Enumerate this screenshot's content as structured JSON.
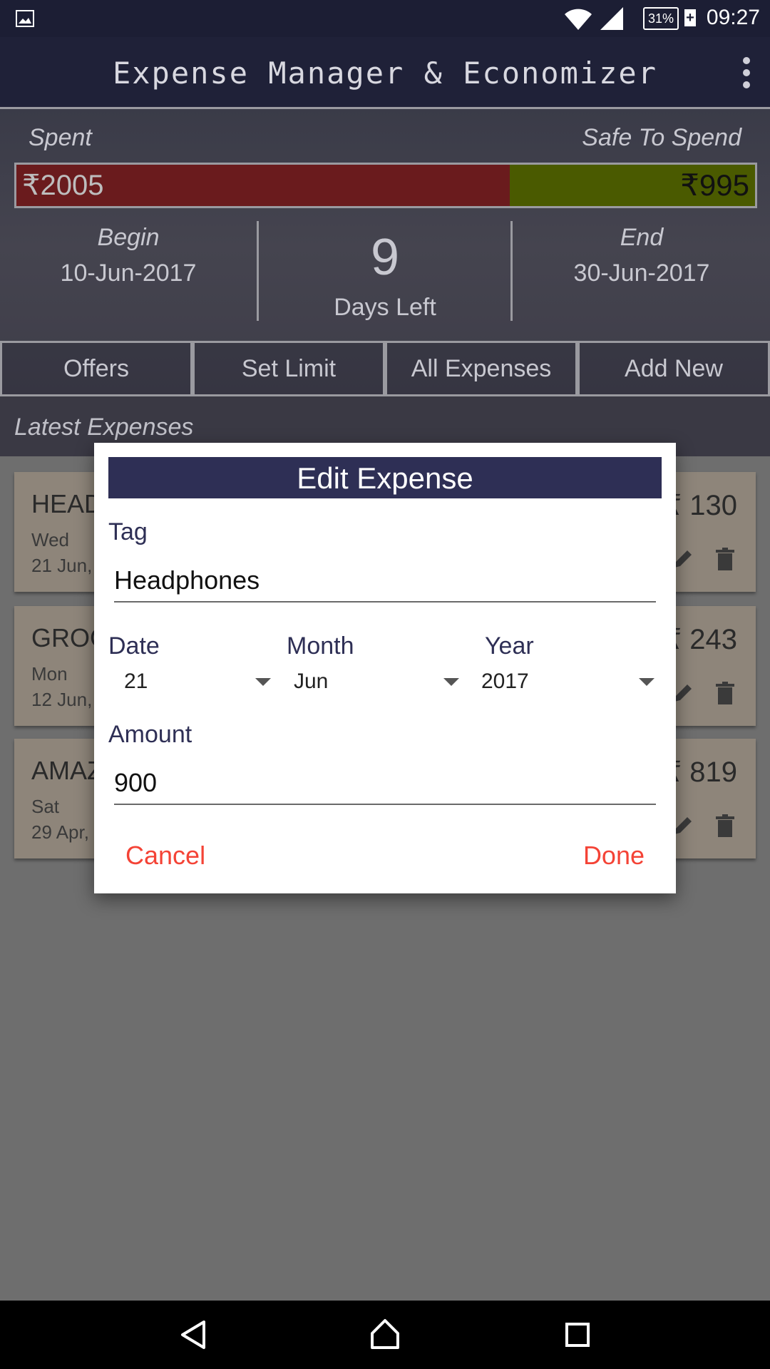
{
  "status_bar": {
    "time": "09:27",
    "battery": "31%",
    "icons": [
      "gallery-icon",
      "wifi-icon",
      "signal-icon",
      "battery-icon"
    ]
  },
  "app_bar": {
    "title": "Expense Manager & Economizer",
    "menu_icon": "more-vert-icon"
  },
  "summary": {
    "spent_label": "Spent",
    "safe_label": "Safe To Spend",
    "spent_value": "₹2005",
    "safe_value": "₹995",
    "spent_fraction": 0.668,
    "begin_label": "Begin",
    "begin_date": "10-Jun-2017",
    "days_left": "9",
    "days_left_label": "Days Left",
    "end_label": "End",
    "end_date": "30-Jun-2017"
  },
  "tabs": [
    {
      "label": "Offers"
    },
    {
      "label": "Set Limit"
    },
    {
      "label": "All Expenses"
    },
    {
      "label": "Add New"
    }
  ],
  "latest_label": "Latest Expenses",
  "expenses": [
    {
      "name": "HEAD",
      "day": "Wed",
      "date": "21 Jun,",
      "amount": "130"
    },
    {
      "name": "GROC",
      "day": "Mon",
      "date": "12 Jun,",
      "amount": "243"
    },
    {
      "name": "AMAZ",
      "day": "Sat",
      "date": "29 Apr,",
      "amount": "819"
    }
  ],
  "dialog": {
    "title": "Edit Expense",
    "tag_label": "Tag",
    "tag_value": "Headphones",
    "date_label": "Date",
    "month_label": "Month",
    "year_label": "Year",
    "date_value": "21",
    "month_value": "Jun",
    "year_value": "2017",
    "amount_label": "Amount",
    "amount_value": "900",
    "cancel_label": "Cancel",
    "done_label": "Done"
  },
  "colors": {
    "spent_bar": "#6a1b1d",
    "safe_bar": "#4a5a00",
    "dialog_title_bg": "#2e2f55",
    "action_text": "#f44336"
  }
}
